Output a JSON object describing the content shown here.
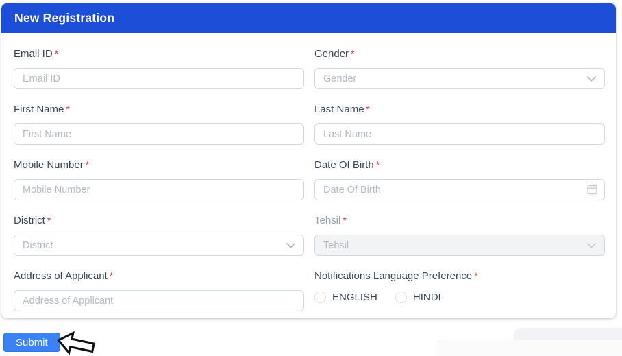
{
  "header": {
    "title": "New Registration"
  },
  "required_marker": "*",
  "fields": {
    "email": {
      "label": "Email ID",
      "placeholder": "Email ID"
    },
    "gender": {
      "label": "Gender",
      "placeholder": "Gender"
    },
    "first_name": {
      "label": "First Name",
      "placeholder": "First Name"
    },
    "last_name": {
      "label": "Last Name",
      "placeholder": "Last Name"
    },
    "mobile": {
      "label": "Mobile Number",
      "placeholder": "Mobile Number"
    },
    "dob": {
      "label": "Date Of Birth",
      "placeholder": "Date Of Birth"
    },
    "district": {
      "label": "District",
      "placeholder": "District"
    },
    "tehsil": {
      "label": "Tehsil",
      "placeholder": "Tehsil",
      "disabled": true
    },
    "address": {
      "label": "Address of Applicant",
      "placeholder": "Address of Applicant"
    },
    "language": {
      "label": "Notifications Language Preference",
      "options": [
        {
          "label": "ENGLISH"
        },
        {
          "label": "HINDI"
        }
      ]
    }
  },
  "submit": {
    "label": "Submit"
  },
  "colors": {
    "header_blue": "#1d4ed8",
    "submit_blue": "#3b82f6",
    "asterisk_red": "#e53e3e",
    "label_text": "#38445a",
    "disabled_label": "#94a1b5",
    "input_border": "#d3d9e0",
    "placeholder": "#b3bac4",
    "disabled_bg": "#f1f3f5"
  }
}
